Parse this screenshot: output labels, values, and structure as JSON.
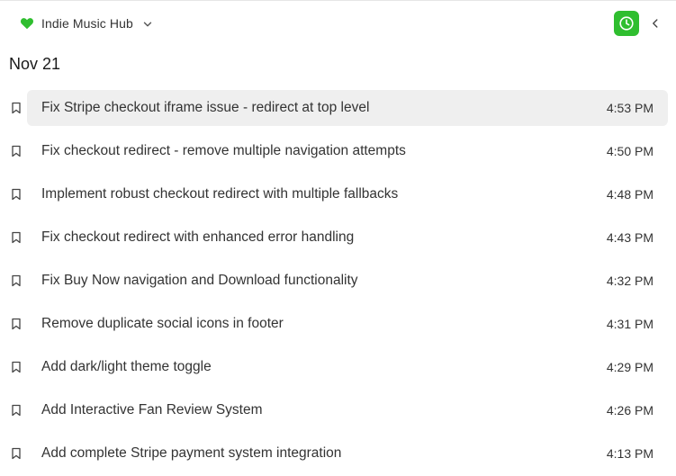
{
  "header": {
    "project_name": "Indie Music Hub",
    "heart_color": "#2fbe2f",
    "history_button_color": "#2fbe2f"
  },
  "history": {
    "date": "Nov 21",
    "items": [
      {
        "title": "Fix Stripe checkout iframe issue - redirect at top level",
        "time": "4:53 PM",
        "active": true
      },
      {
        "title": "Fix checkout redirect - remove multiple navigation attempts",
        "time": "4:50 PM",
        "active": false
      },
      {
        "title": "Implement robust checkout redirect with multiple fallbacks",
        "time": "4:48 PM",
        "active": false
      },
      {
        "title": "Fix checkout redirect with enhanced error handling",
        "time": "4:43 PM",
        "active": false
      },
      {
        "title": "Fix Buy Now navigation and Download functionality",
        "time": "4:32 PM",
        "active": false
      },
      {
        "title": "Remove duplicate social icons in footer",
        "time": "4:31 PM",
        "active": false
      },
      {
        "title": "Add dark/light theme toggle",
        "time": "4:29 PM",
        "active": false
      },
      {
        "title": "Add Interactive Fan Review System",
        "time": "4:26 PM",
        "active": false
      },
      {
        "title": "Add complete Stripe payment system integration",
        "time": "4:13 PM",
        "active": false
      }
    ]
  }
}
